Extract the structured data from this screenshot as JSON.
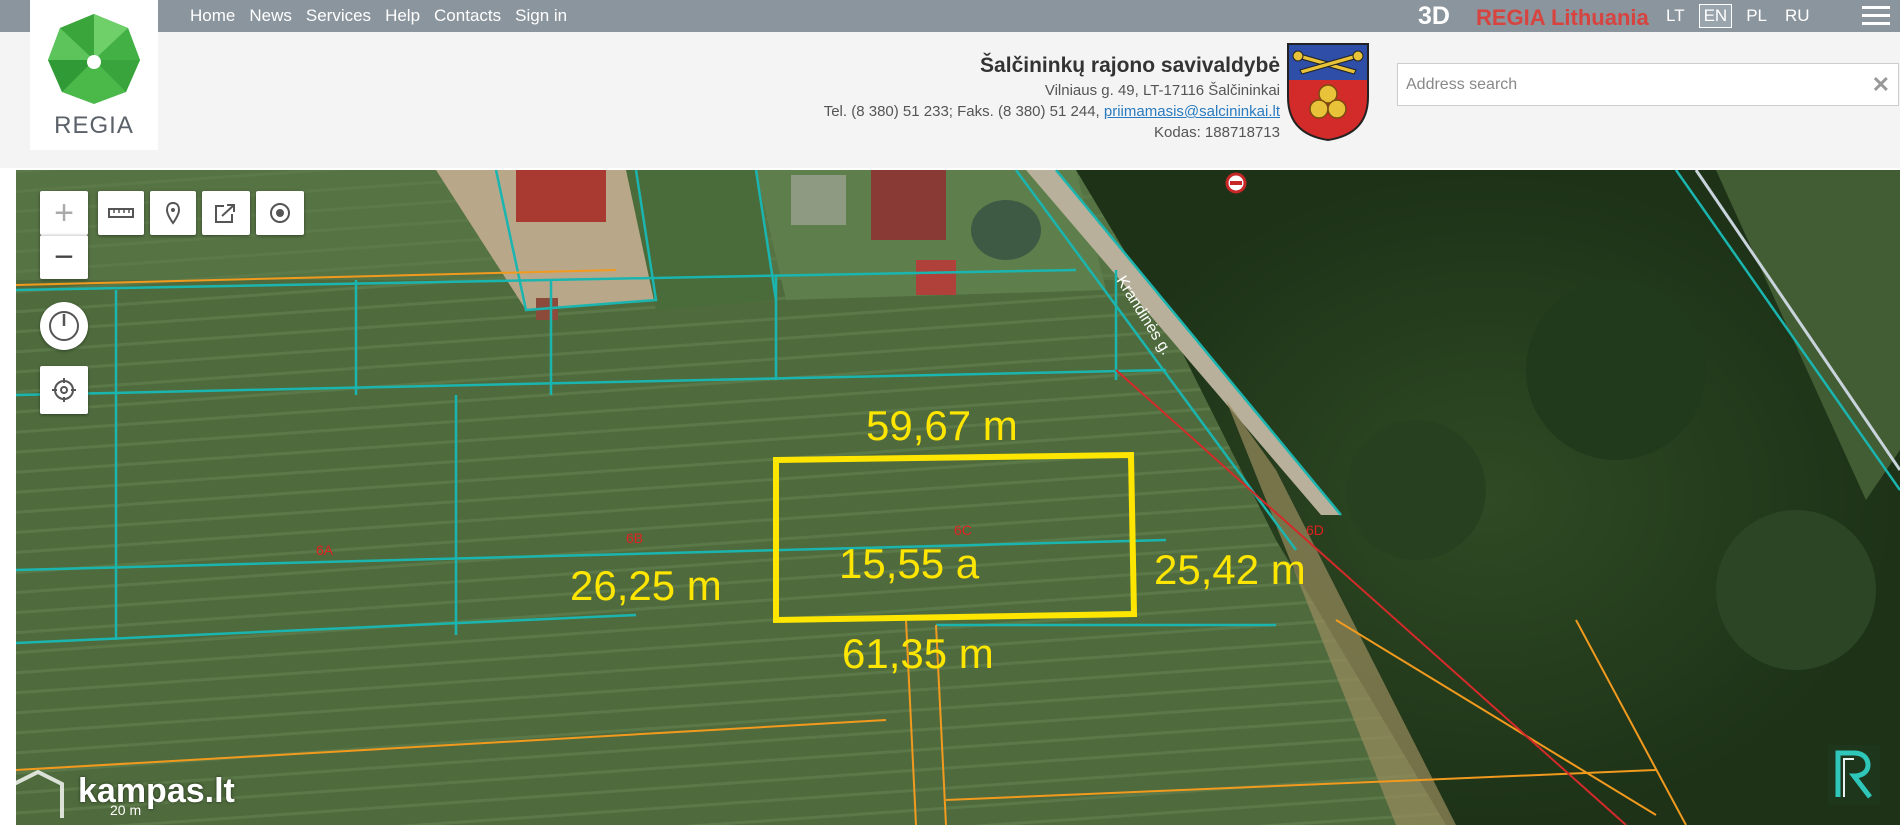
{
  "topbar": {
    "nav": [
      {
        "label": "Home"
      },
      {
        "label": "News"
      },
      {
        "label": "Services"
      },
      {
        "label": "Help"
      },
      {
        "label": "Contacts"
      },
      {
        "label": "Sign in"
      }
    ],
    "three_d_label": "3D",
    "regia_label": "REGIA Lithuania",
    "languages": [
      {
        "code": "LT",
        "active": false
      },
      {
        "code": "EN",
        "active": true
      },
      {
        "code": "PL",
        "active": false
      },
      {
        "code": "RU",
        "active": false
      }
    ],
    "menu_icon": "hamburger-icon"
  },
  "logo": {
    "text": "REGIA",
    "icon": "regia-gem-logo"
  },
  "municipality": {
    "name": "Šalčininkų rajono savivaldybė",
    "address": "Vilniaus g. 49, LT-17116 Šalčininkai",
    "phone_prefix": "Tel. (8 380) 51 233; Faks. (8 380) 51 244, ",
    "email": "priimamasis@salcininkai.lt",
    "code": "Kodas: 188718713",
    "coat_of_arms": "salcininkai-coat-of-arms"
  },
  "search": {
    "placeholder": "Address search",
    "clear_icon": "clear-icon"
  },
  "map_controls": [
    {
      "name": "zoom-in",
      "icon": "plus-icon"
    },
    {
      "name": "zoom-out",
      "icon": "minus-icon"
    },
    {
      "name": "measure",
      "icon": "ruler-icon"
    },
    {
      "name": "place-marker",
      "icon": "marker-icon"
    },
    {
      "name": "share",
      "icon": "share-icon"
    },
    {
      "name": "locate",
      "icon": "target-icon"
    },
    {
      "name": "rotate",
      "icon": "compass-icon"
    },
    {
      "name": "my-location",
      "icon": "crosshair-icon"
    }
  ],
  "map": {
    "street_label": "Krandinės g.",
    "parcel_labels": [
      "6A",
      "6B",
      "6C",
      "6D"
    ],
    "selected_parcel": {
      "area": "15,55 a",
      "side_top": "59,67 m",
      "side_left": "26,25 m",
      "side_right": "25,42 m",
      "side_bottom": "61,35 m",
      "highlight_color": "#ffe600"
    },
    "scale_label": "20 m",
    "boundary_colors": {
      "cadastral": "#1bb5b0",
      "road": "#f29a1e",
      "red_line": "#d42a2a"
    }
  },
  "watermark": {
    "text": "kampas.lt"
  }
}
